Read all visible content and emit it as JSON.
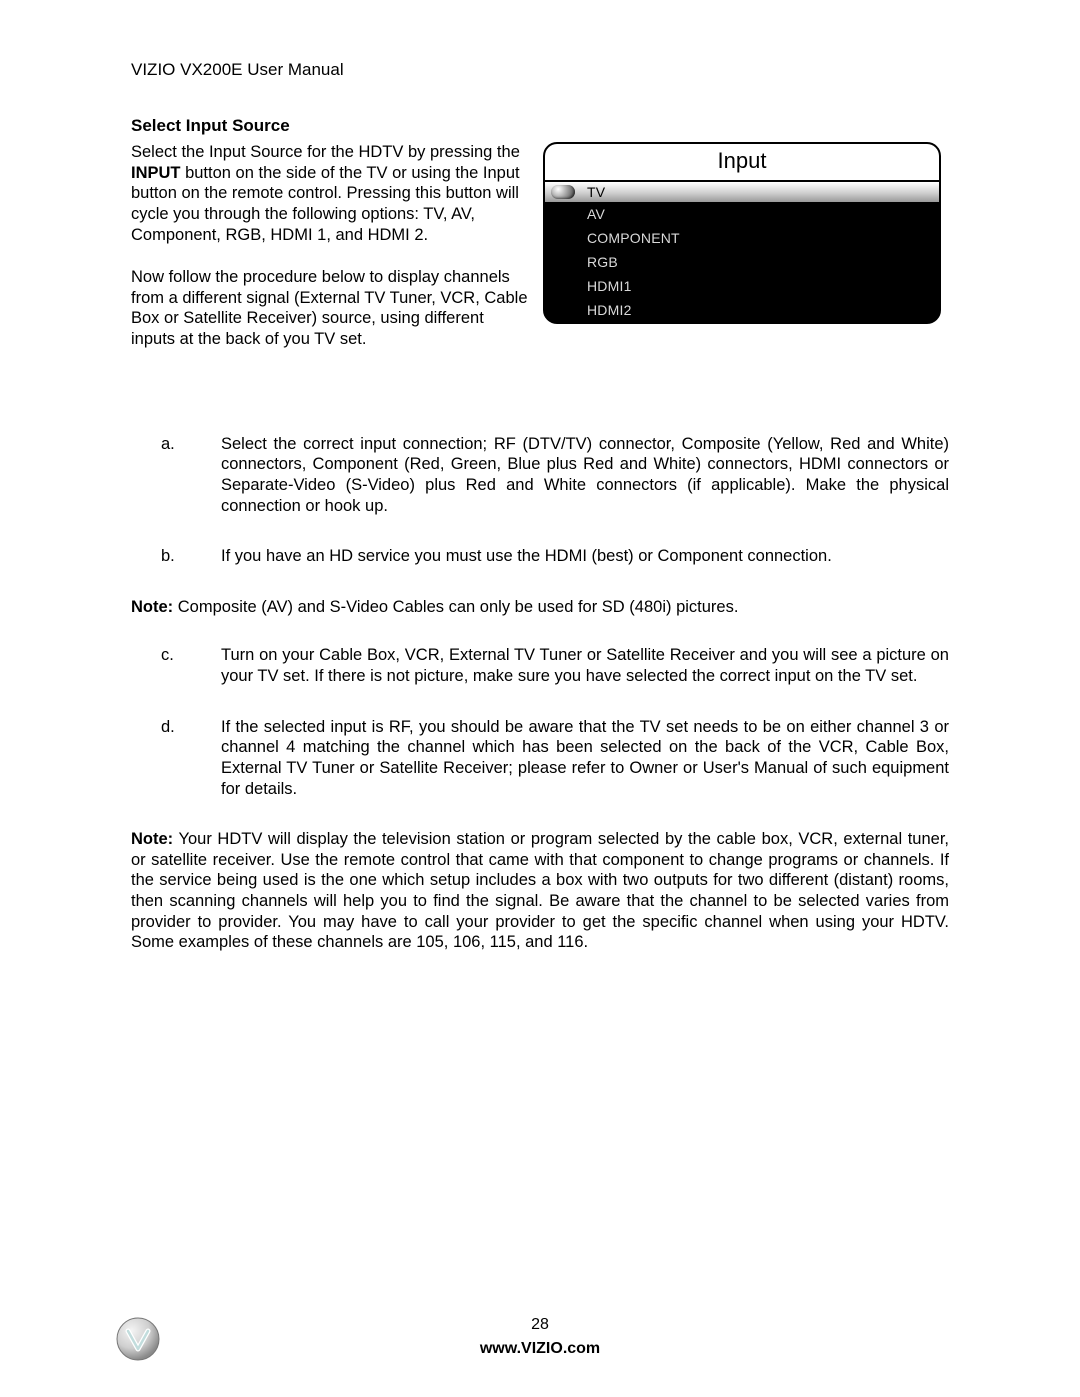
{
  "header": {
    "title": "VIZIO VX200E User Manual"
  },
  "section": {
    "title": "Select Input Source"
  },
  "intro": {
    "p1a": "Select the Input Source for the HDTV by pressing the ",
    "p1b_bold": "INPUT",
    "p1c": " button on the side of the TV or using the Input button on the remote control.  Pressing this button will cycle you through the following options: TV, AV, Component, RGB, HDMI 1, and HDMI 2.",
    "p2": "Now follow the procedure below to display channels from a different signal (External TV Tuner, VCR, Cable Box or Satellite Receiver) source, using different inputs at the back of you TV set."
  },
  "input_menu": {
    "title": "Input",
    "items": [
      "TV",
      "AV",
      "COMPONENT",
      "RGB",
      "HDMI1",
      "HDMI2"
    ],
    "selected_index": 0
  },
  "steps": {
    "a": {
      "marker": "a.",
      "text": "Select the correct input connection; RF (DTV/TV) connector, Composite (Yellow, Red and White) connectors, Component (Red, Green, Blue plus Red and White) connectors, HDMI connectors or Separate-Video (S-Video) plus Red and White connectors (if applicable). Make the physical connection or hook up."
    },
    "b": {
      "marker": "b.",
      "text": "If you have an HD service you must use the HDMI (best) or Component connection."
    },
    "c": {
      "marker": "c.",
      "text": "Turn on your Cable Box, VCR, External TV Tuner or Satellite Receiver and you will see a picture on your TV set. If there is not picture, make sure you have selected the correct input on the TV set."
    },
    "d": {
      "marker": "d.",
      "text": "If the selected input is RF, you should be aware that the TV set needs to be on either channel 3 or channel 4 matching the channel which has been selected on the back of the VCR, Cable Box, External TV Tuner or Satellite Receiver; please refer to Owner or User's Manual of such equipment for details."
    }
  },
  "notes": {
    "note1_label": "Note:",
    "note1_text": "  Composite (AV) and S-Video Cables can only be used for SD (480i) pictures.",
    "note2_label": "Note:",
    "note2_text": " Your HDTV will display the television station or program selected by the cable box, VCR, external tuner, or satellite receiver. Use the remote control that came with that component to change programs or channels. If the service being used is the one which setup includes a box with two outputs for two different (distant) rooms, then scanning channels will help you to find the signal. Be aware that the channel to be selected varies from provider to provider. You may have to call your provider to get the specific channel when using your HDTV. Some examples of these channels are 105, 106, 115, and 116."
  },
  "footer": {
    "page_number": "28",
    "url": "www.VIZIO.com"
  }
}
